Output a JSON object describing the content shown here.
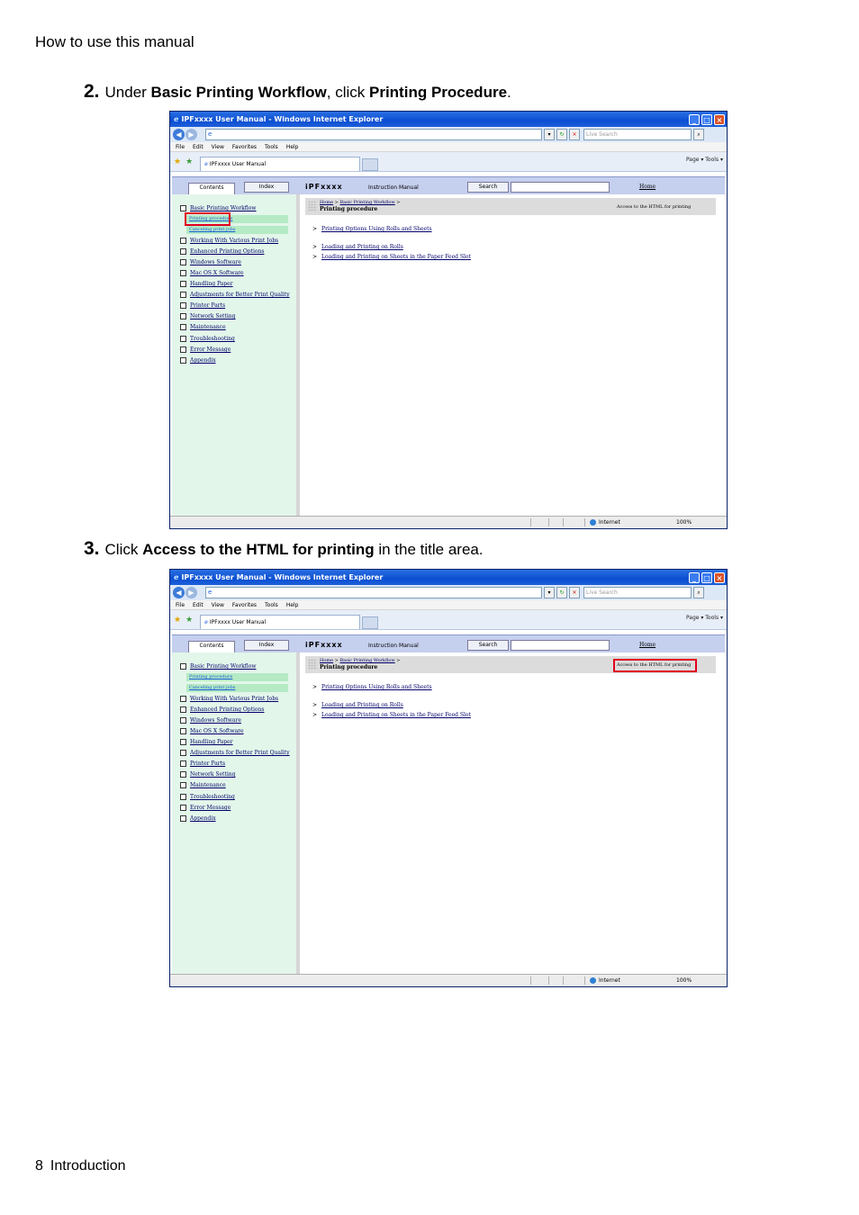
{
  "page": {
    "header": "How to use this manual",
    "footer_page": "8",
    "footer_section": "Introduction"
  },
  "steps": [
    {
      "number": "2.",
      "prefix": "Under ",
      "bold1": "Basic Printing Workflow",
      "middle": ", click ",
      "bold2": "Printing Procedure",
      "suffix": "."
    },
    {
      "number": "3.",
      "prefix": "Click ",
      "bold1": "Access to the HTML for printing",
      "middle": " in the title area."
    }
  ],
  "ie": {
    "window_title": "IPFxxxx User Manual - Windows Internet Explorer",
    "search_placeholder": "Live Search",
    "menu": [
      "File",
      "Edit",
      "View",
      "Favorites",
      "Tools",
      "Help"
    ],
    "tab_title": "IPFxxxx User Manual",
    "toolbar_right": "Page ▾  Tools ▾",
    "contents_tab": "Contents",
    "index_tab": "Index",
    "brand": "iPFxxxx",
    "brand_sub": "Instruction Manual",
    "search_button": "Search",
    "home_link": "Home",
    "status_zone": "Internet",
    "status_zoom": "100%",
    "sidebar": {
      "basic": "Basic Printing Workflow",
      "sub1": "Printing procedure",
      "sub2": "Canceling print jobs",
      "items": [
        "Working With Various Print Jobs",
        "Enhanced Printing Options",
        "Windows Software",
        "Mac OS X Software",
        "Handling Paper",
        "Adjustments for Better Print Quality",
        "Printer Parts",
        "Network Setting",
        "Maintenance",
        "Troubleshooting",
        "Error Message",
        "Appendix"
      ]
    },
    "main": {
      "crumb_home": "Home",
      "crumb_sep": " > ",
      "crumb_section": "Basic Printing Workflow",
      "crumb_end": " >",
      "title": "Printing procedure",
      "access_link": "Access to the HTML for printing",
      "links": [
        "Printing Options Using Rolls and Sheets",
        "Loading and Printing on Rolls",
        "Loading and Printing on Sheets in the Paper Feed Slot"
      ]
    }
  },
  "colors": {
    "highlight": "#e0001c",
    "sidebar_bg": "#e3f6ea",
    "titlebar": "#0b4fd1"
  }
}
